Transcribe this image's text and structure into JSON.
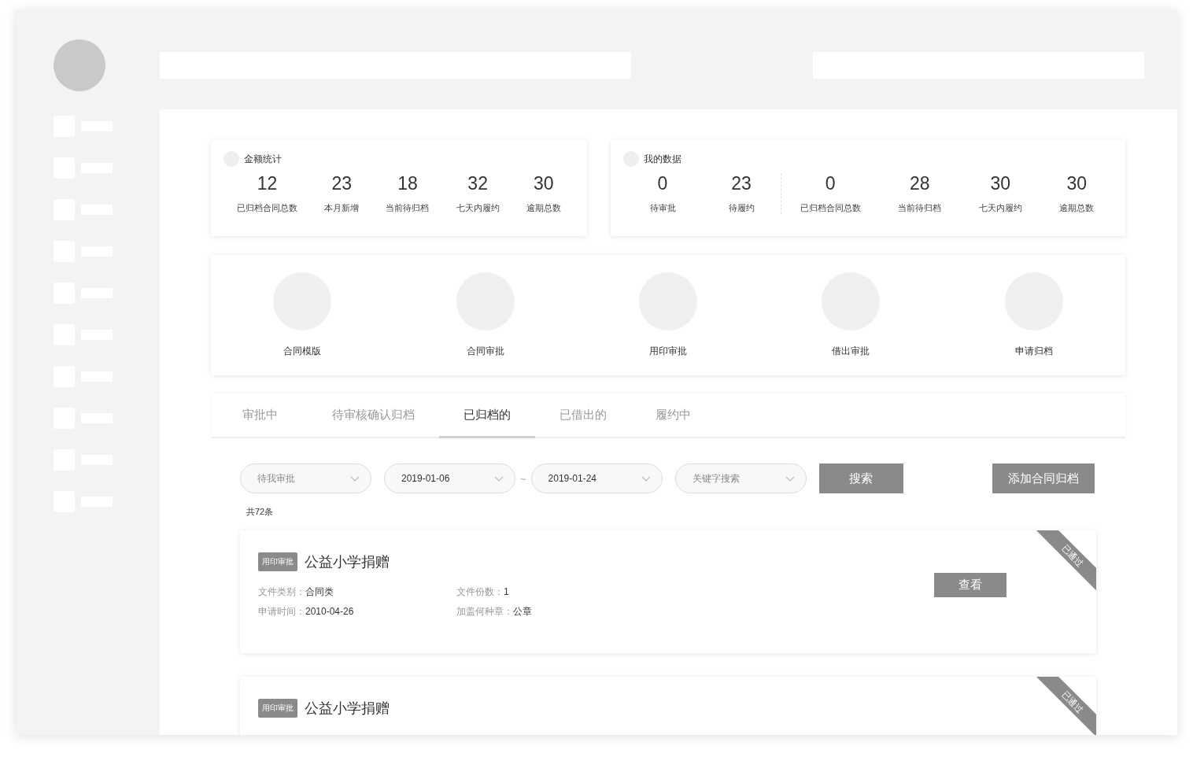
{
  "stats": [
    {
      "title": "金额统计",
      "sections": [
        {
          "items": [
            {
              "value": "12",
              "label": "已归档合同总数"
            },
            {
              "value": "23",
              "label": "本月新增"
            },
            {
              "value": "18",
              "label": "当前待归档"
            },
            {
              "value": "32",
              "label": "七天内履约"
            },
            {
              "value": "30",
              "label": "逾期总数"
            }
          ]
        }
      ]
    },
    {
      "title": "我的数据",
      "sections": [
        {
          "items": [
            {
              "value": "0",
              "label": "待审批"
            },
            {
              "value": "23",
              "label": "待履约"
            }
          ]
        },
        {
          "items": [
            {
              "value": "0",
              "label": "已归档合同总数"
            },
            {
              "value": "28",
              "label": "当前待归档"
            },
            {
              "value": "30",
              "label": "七天内履约"
            },
            {
              "value": "30",
              "label": "逾期总数"
            }
          ]
        }
      ]
    }
  ],
  "shortcuts": [
    {
      "label": "合同模版"
    },
    {
      "label": "合同审批"
    },
    {
      "label": "用印审批"
    },
    {
      "label": "借出审批"
    },
    {
      "label": "申请归档"
    }
  ],
  "tabs": [
    {
      "label": "审批中",
      "selected": false
    },
    {
      "label": "待审核确认归档",
      "selected": false
    },
    {
      "label": "已归档的",
      "selected": true
    },
    {
      "label": "已借出的",
      "selected": false
    },
    {
      "label": "履约中",
      "selected": false
    }
  ],
  "filters": {
    "status": {
      "placeholder": "待我审批"
    },
    "date_from": {
      "value": "2019-01-06"
    },
    "range_separator": "~",
    "date_to": {
      "value": "2019-01-24"
    },
    "keyword": {
      "placeholder": "关键字搜索"
    },
    "search_button": "搜索",
    "add_button": "添加合同归档"
  },
  "count": "共72条",
  "records": [
    {
      "tag": "用印审批",
      "title": "公益小学捐赠",
      "status": "已通过",
      "fields": [
        {
          "label": "文件类别：",
          "value": "合同类"
        },
        {
          "label": "文件份数：",
          "value": "1"
        },
        {
          "label": "申请时间：",
          "value": "2010-04-26"
        },
        {
          "label": "加盖何种章：",
          "value": "公章"
        }
      ],
      "button": "查看"
    },
    {
      "tag": "用印审批",
      "title": "公益小学捐赠",
      "status": "已通过"
    }
  ]
}
